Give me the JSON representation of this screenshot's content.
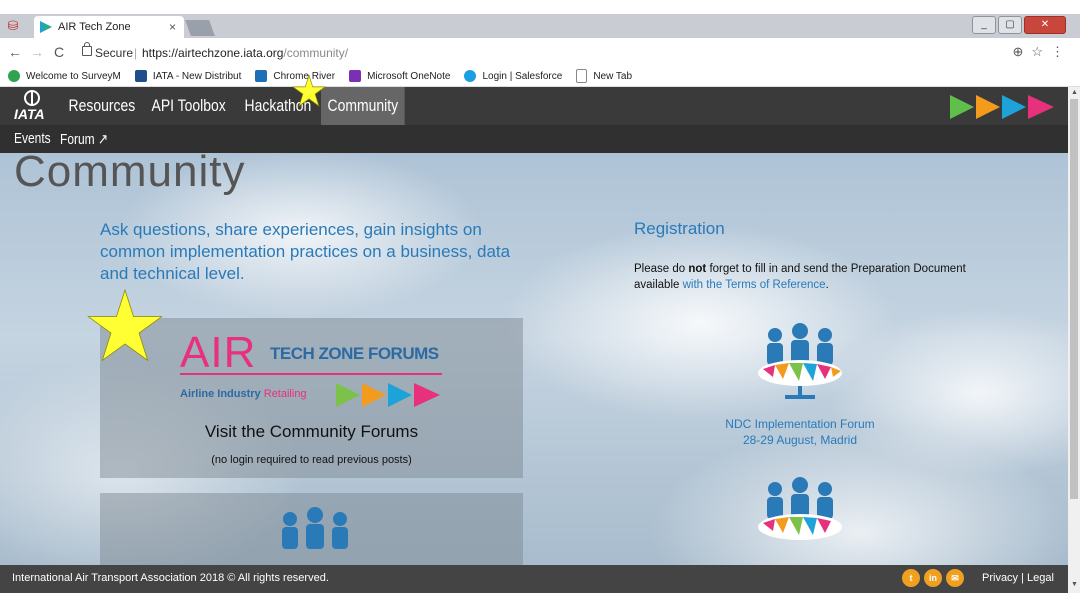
{
  "browser": {
    "tab_title": "AIR Tech Zone",
    "tab_close": "×",
    "secure_label": "Secure",
    "url_base": "https://airtechzone.iata.org",
    "url_path": "/community/",
    "bookmarks": [
      {
        "label": "Welcome to SurveyM",
        "color": "#2ea44f"
      },
      {
        "label": "IATA - New Distribut",
        "color": "#1f4e8c"
      },
      {
        "label": "Chrome River",
        "color": "#1d6fb8"
      },
      {
        "label": "Microsoft OneNote",
        "color": "#7b2fb5"
      },
      {
        "label": "Login | Salesforce",
        "color": "#1aa0e0"
      },
      {
        "label": "New Tab",
        "color": "#ffffff"
      }
    ]
  },
  "site": {
    "logo_text": "IATA",
    "nav": [
      "Resources",
      "API Toolbox",
      "Hackathon",
      "Community"
    ],
    "subnav": [
      "Events",
      "Forum ↗"
    ],
    "page_title": "Community",
    "intro": "Ask questions, share experiences, gain insights on common implementation practices on a business, data and technical level.",
    "registration": {
      "title": "Registration",
      "text_before": "Please do ",
      "text_bold": "not",
      "text_mid": " forget to fill in and send the Preparation Document available ",
      "text_link": "with the Terms of Reference",
      "text_end": "."
    },
    "forum_card": {
      "air": "AIR",
      "tech_zone_forums": "TECH ZONE FORUMS",
      "subtitle_a": "Airline Industry ",
      "subtitle_b": "Retailing",
      "visit": "Visit the Community Forums",
      "no_login": "(no login required to read previous posts)"
    },
    "event": {
      "name": "NDC Implementation Forum",
      "date": "28-29 August, Madrid"
    },
    "footer": {
      "copyright": "International Air Transport Association 2018 © All rights reserved.",
      "privacy": "Privacy",
      "legal": "Legal",
      "separator": "|"
    },
    "colors": {
      "accent_blue": "#2a7ab8",
      "brand_pink": "#e8317c",
      "nav_bg": "#3a3a3a"
    }
  }
}
